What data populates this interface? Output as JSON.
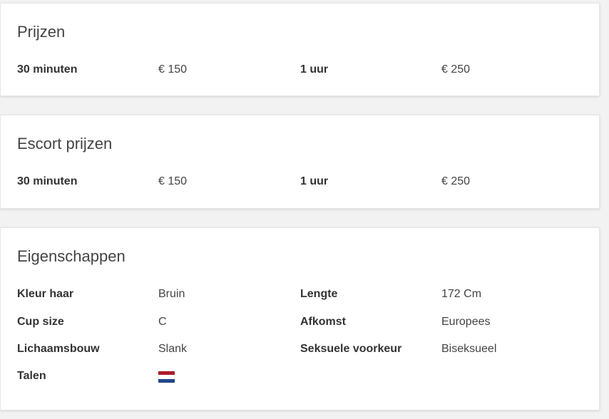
{
  "prices": {
    "title": "Prijzen",
    "rows": [
      {
        "label1": "30 minuten",
        "value1": "€ 150",
        "label2": "1 uur",
        "value2": "€ 250"
      }
    ]
  },
  "escort_prices": {
    "title": "Escort prijzen",
    "rows": [
      {
        "label1": "30 minuten",
        "value1": "€ 150",
        "label2": "1 uur",
        "value2": "€ 250"
      }
    ]
  },
  "properties": {
    "title": "Eigenschappen",
    "rows": [
      {
        "label1": "Kleur haar",
        "value1": "Bruin",
        "label2": "Lengte",
        "value2": "172 Cm"
      },
      {
        "label1": "Cup size",
        "value1": "C",
        "label2": "Afkomst",
        "value2": "Europees"
      },
      {
        "label1": "Lichaamsbouw",
        "value1": "Slank",
        "label2": "Seksuele voorkeur",
        "value2": "Biseksueel"
      }
    ],
    "languages": {
      "label": "Talen",
      "flags": [
        {
          "icon": "netherlands-flag-icon",
          "colors": [
            "#ae1c28",
            "#ffffff",
            "#21468b"
          ]
        }
      ]
    }
  }
}
